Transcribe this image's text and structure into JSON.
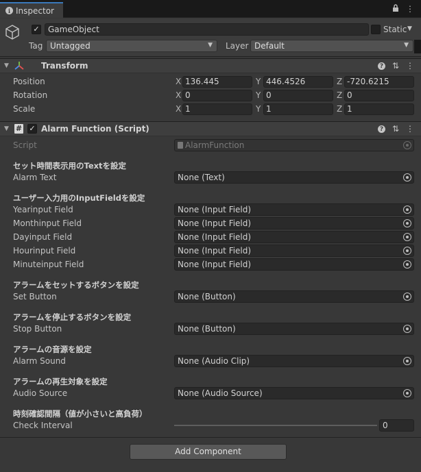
{
  "tab": {
    "label": "Inspector",
    "lock_glyph": "🔒",
    "menu_glyph": "⋮"
  },
  "gameobject": {
    "name": "GameObject",
    "active_check": "✓",
    "static_label": "Static",
    "tag_label": "Tag",
    "tag_value": "Untagged",
    "layer_label": "Layer",
    "layer_value": "Default"
  },
  "transform": {
    "title": "Transform",
    "rows": [
      {
        "label": "Position",
        "x": "136.445",
        "y": "446.4526",
        "z": "-720.6215"
      },
      {
        "label": "Rotation",
        "x": "0",
        "y": "0",
        "z": "0"
      },
      {
        "label": "Scale",
        "x": "1",
        "y": "1",
        "z": "1"
      }
    ],
    "axis_x": "X",
    "axis_y": "Y",
    "axis_z": "Z"
  },
  "script_component": {
    "title": "Alarm Function (Script)",
    "enabled_check": "✓",
    "hash_glyph": "#",
    "script_label": "Script",
    "script_value": "AlarmFunction",
    "sections": [
      {
        "header": "セット時間表示用のTextを設定",
        "fields": [
          {
            "label": "Alarm Text",
            "value": "None (Text)"
          }
        ]
      },
      {
        "header": "ユーザー入力用のInputFieldを設定",
        "fields": [
          {
            "label": "Yearinput Field",
            "value": "None (Input Field)"
          },
          {
            "label": "Monthinput Field",
            "value": "None (Input Field)"
          },
          {
            "label": "Dayinput Field",
            "value": "None (Input Field)"
          },
          {
            "label": "Hourinput Field",
            "value": "None (Input Field)"
          },
          {
            "label": "Minuteinput Field",
            "value": "None (Input Field)"
          }
        ]
      },
      {
        "header": "アラームをセットするボタンを設定",
        "fields": [
          {
            "label": "Set Button",
            "value": "None (Button)"
          }
        ]
      },
      {
        "header": "アラームを停止するボタンを設定",
        "fields": [
          {
            "label": "Stop Button",
            "value": "None (Button)"
          }
        ]
      },
      {
        "header": "アラームの音源を設定",
        "fields": [
          {
            "label": "Alarm Sound",
            "value": "None (Audio Clip)"
          }
        ]
      },
      {
        "header": "アラームの再生対象を設定",
        "fields": [
          {
            "label": "Audio Source",
            "value": "None (Audio Source)"
          }
        ]
      }
    ],
    "interval_header": "時刻確認間隔（値が小さいと高負荷）",
    "interval_label": "Check Interval",
    "interval_value": "0"
  },
  "add_component_label": "Add Component",
  "icons": {
    "help": "?",
    "settings": "⇅",
    "more": "⋮",
    "foldout": "▼",
    "caret": "▼"
  },
  "colors": {
    "background": "#383838",
    "field": "#2a2a2a",
    "accent": "#3a79bb"
  }
}
